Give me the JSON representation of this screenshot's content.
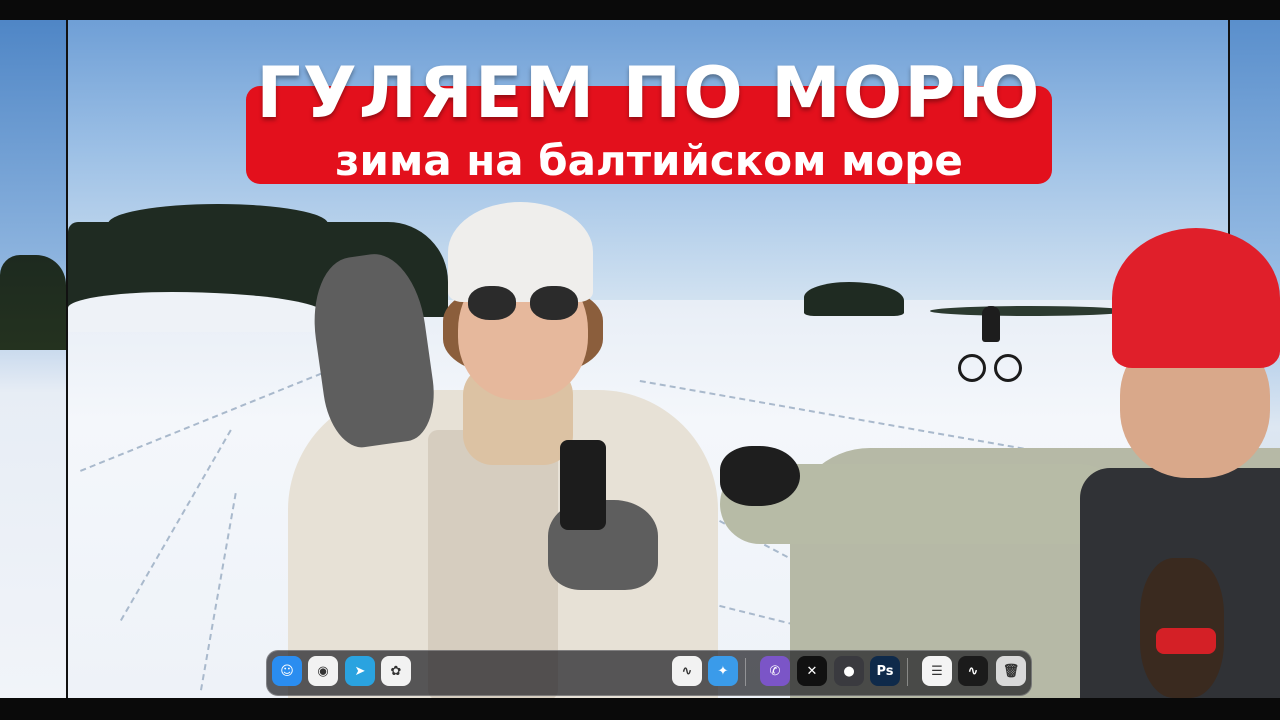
{
  "title": {
    "main": "ГУЛЯЕМ ПО МОРЮ",
    "subtitle": "зима на балтийском море"
  },
  "colors": {
    "banner": "#e3101c",
    "text": "#ffffff",
    "red_hat": "#e01f2a"
  },
  "dock": {
    "items": [
      {
        "name": "finder-icon",
        "glyph": "☺",
        "color": "#2a8df0"
      },
      {
        "name": "chrome-icon",
        "glyph": "◉",
        "color": "#f2f2f2"
      },
      {
        "name": "telegram-icon",
        "glyph": "➤",
        "color": "#2aa3e0"
      },
      {
        "name": "photos-icon",
        "glyph": "✿",
        "color": "#f2f2f2"
      },
      {
        "name": "freeform-icon",
        "glyph": "∿",
        "color": "#f2f2f2"
      },
      {
        "name": "safari-icon",
        "glyph": "✦",
        "color": "#3a9bea"
      },
      {
        "name": "viber-icon",
        "glyph": "✆",
        "color": "#7b55c7"
      },
      {
        "name": "capcut-icon",
        "glyph": "✕",
        "color": "#111111"
      },
      {
        "name": "screenshot-app-icon",
        "glyph": "●",
        "color": "#3a3a3f"
      },
      {
        "name": "photoshop-icon",
        "glyph": "Ps",
        "color": "#0f2a4a"
      },
      {
        "name": "document-icon",
        "glyph": "☰",
        "color": "#f4f4f4"
      },
      {
        "name": "activity-monitor-icon",
        "glyph": "∿",
        "color": "#1b1b1b"
      },
      {
        "name": "trash-icon",
        "glyph": "🗑",
        "color": "#d9d9d9"
      }
    ]
  }
}
